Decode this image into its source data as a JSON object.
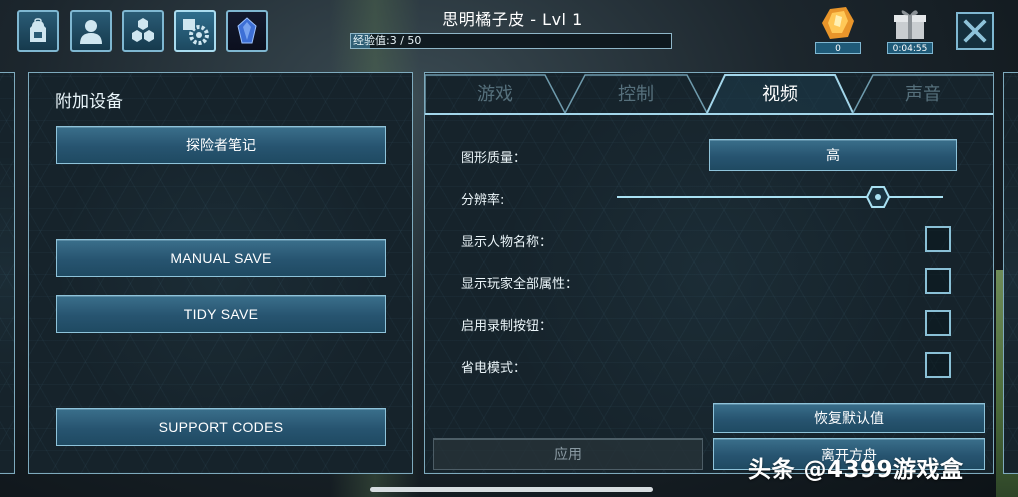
{
  "header": {
    "title": "思明橘子皮 - Lvl 1",
    "xp_label": "经验值:3 / 50",
    "xp_progress": 0.06,
    "resources": [
      {
        "icon": "element-crystal-icon",
        "value": "0"
      },
      {
        "icon": "gift-box-icon",
        "value": "0:04:55"
      }
    ],
    "nav_icons": [
      "backpack-icon",
      "character-icon",
      "tribe-hex-icon",
      "settings-gear-icon",
      "element-icon"
    ]
  },
  "left_panel": {
    "title": "附加设备",
    "buttons": [
      "探险者笔记",
      "MANUAL SAVE",
      "TIDY SAVE",
      "SUPPORT CODES"
    ]
  },
  "tabs": [
    "游戏",
    "控制",
    "视频",
    "声音"
  ],
  "active_tab": "视频",
  "video_settings": {
    "graphics_quality_label": "图形质量：",
    "graphics_quality_value": "高",
    "resolution_label": "分辨率:",
    "resolution_level": 0.8,
    "show_character_names_label": "显示人物名称：",
    "show_all_player_stats_label": "显示玩家全部属性：",
    "enable_record_button_label": "启用录制按钮：",
    "power_saving_mode_label": "省电模式：",
    "checkboxes_checked": [
      false,
      false,
      false,
      false
    ]
  },
  "footer": {
    "apply_label": "应用",
    "restore_defaults_label": "恢复默认值",
    "leave_ark_label": "离开方舟"
  },
  "watermark": "头条 @4399游戏盒",
  "colors": {
    "accent": "#8ec3da",
    "button_fill": "#275470",
    "panel_bg": "#16232b"
  }
}
